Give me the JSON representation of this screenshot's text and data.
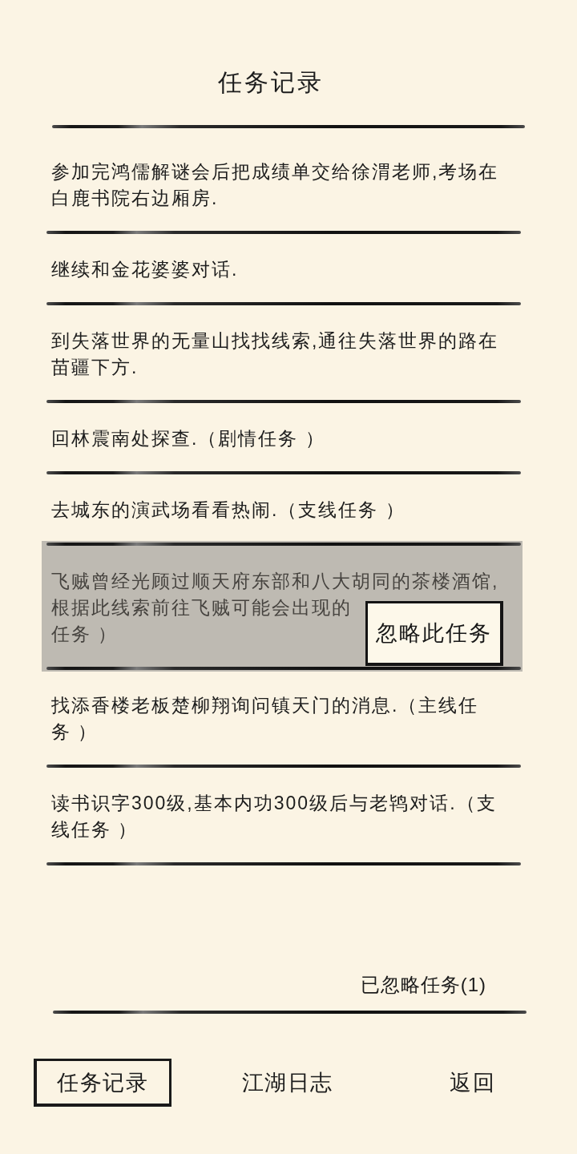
{
  "title": "任务记录",
  "quests": [
    {
      "text": "参加完鸿儒解谜会后把成绩单交给徐渭老师,考场在白鹿书院右边厢房.",
      "selected": false
    },
    {
      "text": "继续和金花婆婆对话.",
      "selected": false
    },
    {
      "text": "到失落世界的无量山找找线索,通往失落世界的路在苗疆下方.",
      "selected": false
    },
    {
      "text": "回林震南处探查.（剧情任务 ）",
      "selected": false
    },
    {
      "text": "去城东的演武场看看热闹.（支线任务 ）",
      "selected": false
    },
    {
      "text": "飞贼曾经光顾过顺天府东部和八大胡同的茶楼酒馆,根据此线索前往飞贼可能会出现的",
      "text_continued": "任务 ）",
      "selected": true,
      "action_button": "忽略此任务"
    },
    {
      "text": "找添香楼老板楚柳翔询问镇天门的消息.（主线任务 ）",
      "selected": false
    },
    {
      "text": "读书识字300级,基本内功300级后与老鸨对话.（支线任务 ）",
      "selected": false
    }
  ],
  "ignored_link": "已忽略任务(1)",
  "bottom_nav": {
    "tabs": [
      {
        "label": "任务记录",
        "selected": true
      },
      {
        "label": "江湖日志",
        "selected": false
      }
    ],
    "back_button": "返回"
  }
}
